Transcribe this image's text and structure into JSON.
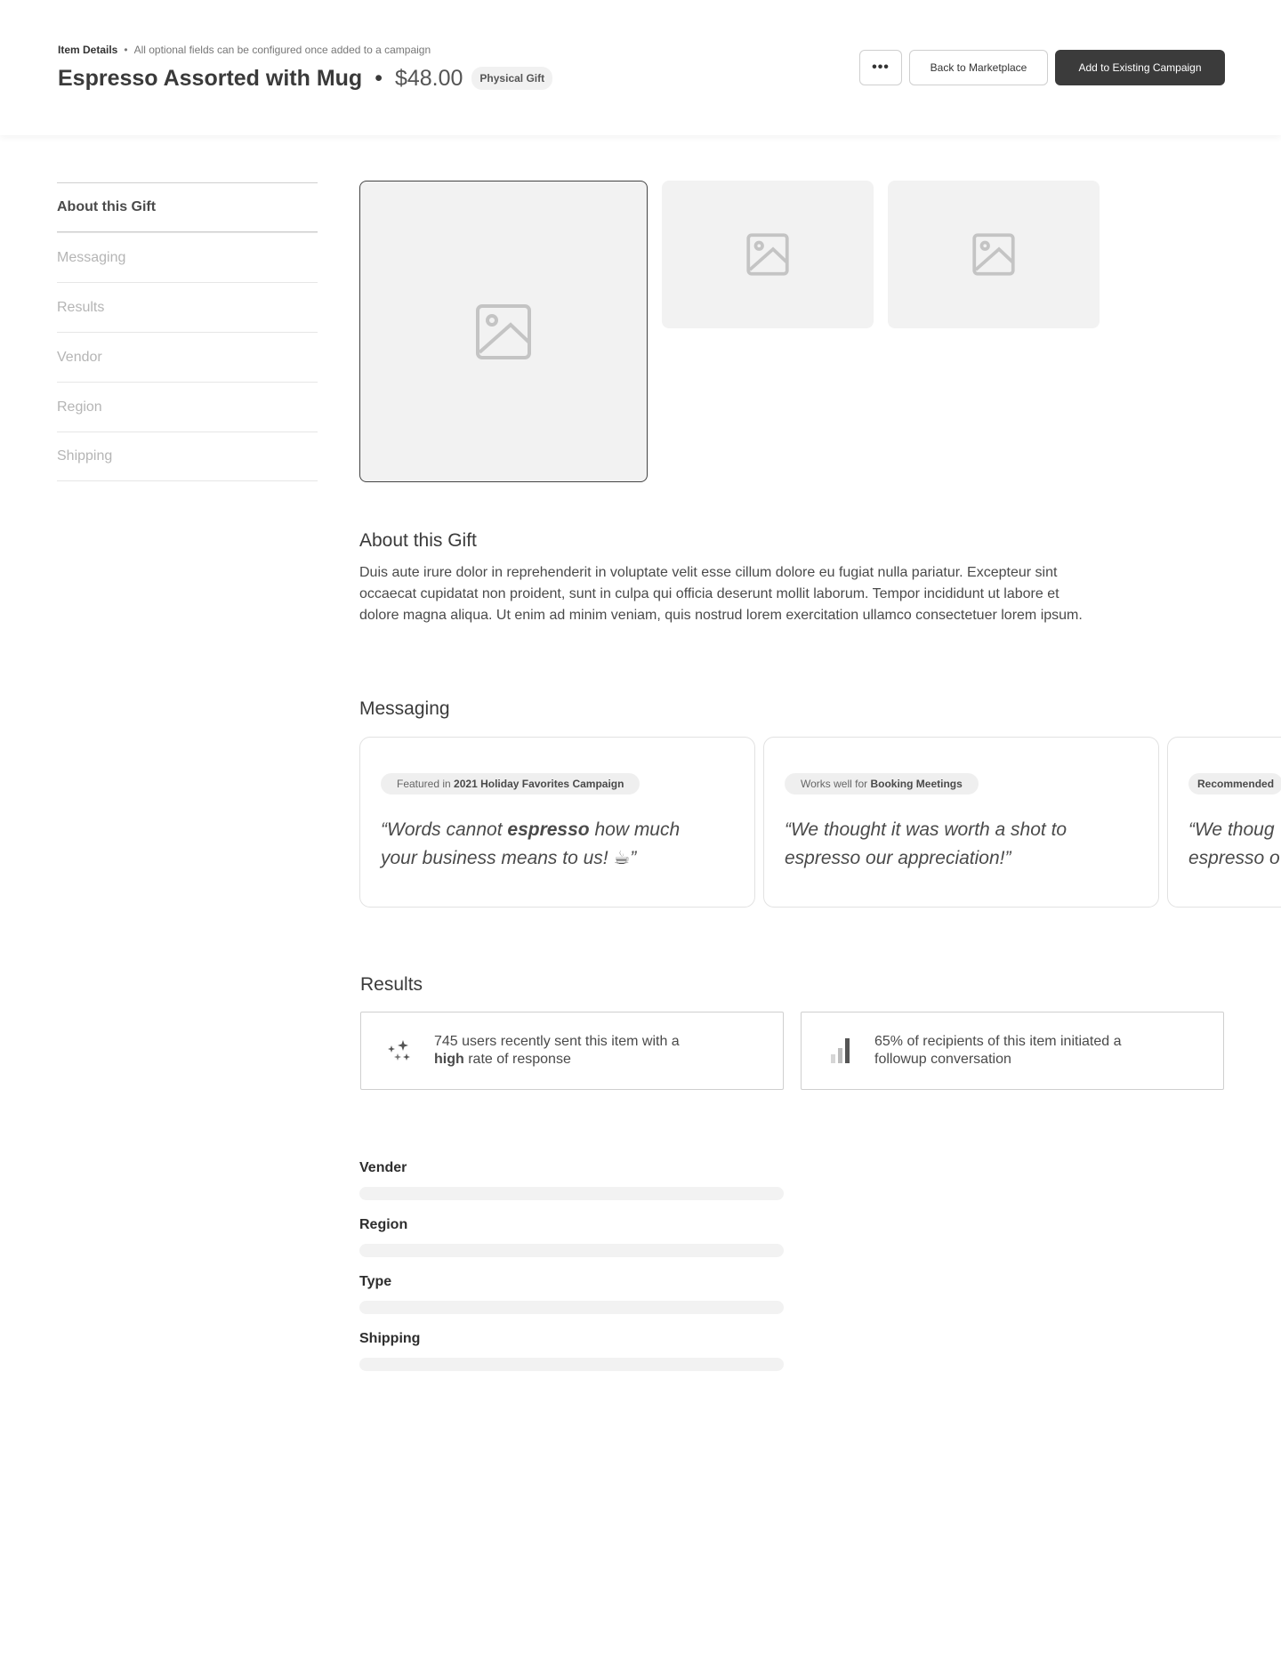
{
  "header": {
    "breadcrumb_label": "Item Details",
    "breadcrumb_note": "All optional fields can be configured once added to a campaign",
    "title": "Espresso Assorted with Mug",
    "separator": "•",
    "price": "$48.00",
    "badge": "Physical Gift",
    "more_label": "•••",
    "back_label": "Back to Marketplace",
    "add_label": "Add to Existing Campaign"
  },
  "sidebar": {
    "items": [
      {
        "label": "About this Gift",
        "active": true
      },
      {
        "label": "Messaging"
      },
      {
        "label": "Results"
      },
      {
        "label": "Vendor"
      },
      {
        "label": "Region"
      },
      {
        "label": "Shipping"
      }
    ]
  },
  "about": {
    "heading": "About this Gift",
    "body": "Duis aute irure dolor in reprehenderit in voluptate velit esse cillum dolore eu fugiat nulla pariatur. Excepteur sint occaecat cupidatat non proident, sunt in culpa qui officia deserunt mollit laborum. Tempor incididunt ut labore et dolore magna aliqua. Ut enim ad minim veniam, quis nostrud lorem exercitation ullamco consectetuer lorem ipsum."
  },
  "messaging": {
    "heading": "Messaging",
    "cards": [
      {
        "chip_prefix": "Featured in",
        "chip_bold": "2021 Holiday Favorites Campaign",
        "quote_pre": "“Words cannot ",
        "quote_bold": "espresso",
        "quote_post": " how much",
        "quote_line2": "your business means to us! ☕”"
      },
      {
        "chip_prefix": "Works well for",
        "chip_bold": "Booking Meetings",
        "quote_line1": "“We thought it was worth a shot to",
        "quote_line2": "espresso our appreciation!”"
      },
      {
        "chip_bold": "Recommended",
        "quote_line1": "“We thoug",
        "quote_line2": "espresso o"
      }
    ]
  },
  "results": {
    "heading": "Results",
    "cards": [
      {
        "icon": "sparkles-icon",
        "line1": "745 users recently sent this item with a",
        "bold": "high",
        "line2_rest": " rate of response"
      },
      {
        "icon": "bar-chart-icon",
        "line1": "65% of recipients of this item initiated a",
        "line2": "followup conversation"
      }
    ]
  },
  "details": {
    "fields": [
      {
        "label": "Vender"
      },
      {
        "label": "Region"
      },
      {
        "label": "Type"
      },
      {
        "label": "Shipping"
      }
    ]
  }
}
